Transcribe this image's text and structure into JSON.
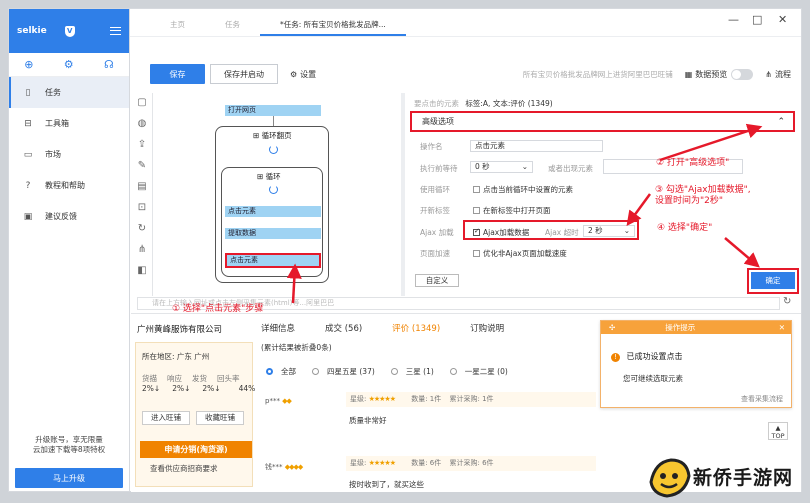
{
  "sidebar": {
    "brand": "selkie",
    "items": [
      {
        "label": "任务",
        "icon": "document-icon"
      },
      {
        "label": "工具箱",
        "icon": "toolbox-icon"
      },
      {
        "label": "市场",
        "icon": "market-icon"
      },
      {
        "label": "教程和帮助",
        "icon": "help-icon"
      },
      {
        "label": "建议反馈",
        "icon": "feedback-icon"
      }
    ],
    "promo_line1": "升级账号，享无限量",
    "promo_line2": "云加速下载等8项特权",
    "upgrade_label": "马上升级"
  },
  "tabs": [
    {
      "label": "主页"
    },
    {
      "label": "任务"
    },
    {
      "label": "*任务: 所有宝贝价格批发品牌..."
    }
  ],
  "toolbar": {
    "save_label": "保存",
    "save_run_label": "保存并启动",
    "settings_label": "设置",
    "hint": "所有宝贝价格批发品牌网上进货阿里巴巴旺铺",
    "data_preview_label": "数据预览",
    "flow_label": "流程"
  },
  "workflow": {
    "open_page": "打开网页",
    "loop_paginate": "循环翻页",
    "loop": "循环",
    "click_element": "点击元素",
    "extract_data": "提取数据",
    "click_element2": "点击元素"
  },
  "props": {
    "current_label": "要点击的元素",
    "current_value": "标签:A, 文本:评价 (1349)",
    "advanced": "高级选项",
    "op_name_label": "操作名",
    "op_name_value": "点击元素",
    "wait_label": "执行前等待",
    "wait_value": "0 秒",
    "or_label": "或者出现元素",
    "use_loop_label": "使用循环",
    "use_loop_text": "点击当前循环中设置的元素",
    "new_tab_label": "开新标签",
    "new_tab_text": "在新标签中打开页面",
    "ajax_label": "Ajax 加载",
    "ajax_text": "Ajax加载数据",
    "ajax_timeout_label": "Ajax 超时",
    "ajax_timeout_value": "2 秒",
    "page_speed_label": "页面加速",
    "page_speed_text": "优化非Ajax页面加载速度",
    "custom_label": "自定义",
    "confirm_label": "确定"
  },
  "annotations": {
    "a1": "① 选择\"点击元素\"步骤",
    "a2": "② 打开\"高级选项\"",
    "a3_line1": "③ 勾选\"Ajax加载数据\",",
    "a3_line2": "设置时间为\"2秒\"",
    "a4": "④ 选择\"确定\""
  },
  "url_placeholder": "请在上方输入网址或点击左侧采集元素(html)等...阿里巴巴",
  "page": {
    "shop": "广州黄峰服饰有限公司",
    "tabs": [
      "详细信息",
      "成交 (56)",
      "评价 (1349)",
      "订购说明"
    ],
    "location": "所在地区: 广东 广州",
    "metrics_labels": [
      "货描",
      "响应",
      "发货",
      "回头率"
    ],
    "metrics_values": [
      "2%↓",
      "2%↓",
      "2%↓",
      "44%"
    ],
    "btn_contact": "进入旺铺",
    "btn_fav": "收藏旺铺",
    "btn_apply": "申请分销(淘货源)",
    "supply_link": "查看供应商招商要求",
    "review_header": "(累计结果被折叠0条)",
    "filters": [
      "全部",
      "四星五星 (37)",
      "三星 (1)",
      "一星二星 (0)"
    ],
    "review1_meta": "星级:",
    "review1_qty": "数量: 1件",
    "review1_total": "累计采购: 1件",
    "review1_text": "质量非常好",
    "review2_qty": "数量: 6件",
    "review2_total": "累计采购: 6件",
    "review2_text": "按时收到了，就买这些"
  },
  "toast": {
    "title": "操作提示",
    "message": "已成功设置点击",
    "sub": "您可继续选取元素",
    "footer": "查看采集流程"
  },
  "top_btn": "TOP",
  "watermark": "新侨手游网",
  "colors": {
    "accent": "#2f7fe8",
    "annotation": "#e5192a",
    "orange": "#f08300"
  }
}
